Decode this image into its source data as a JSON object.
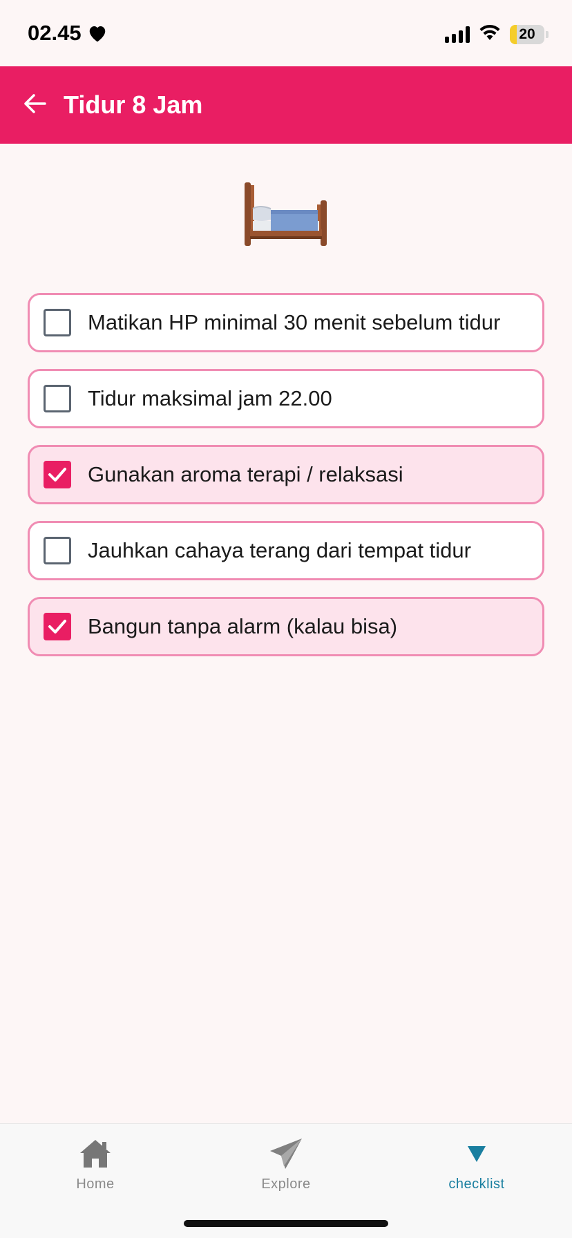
{
  "status_bar": {
    "time": "02.45",
    "battery_level": "20",
    "battery_fraction": 0.2
  },
  "app_bar": {
    "title": "Tidur 8 Jam",
    "back_icon": "arrow-left-icon",
    "background_color": "#e91e63"
  },
  "hero": {
    "emoji": "🛏️",
    "icon": "bed-icon"
  },
  "checklist": {
    "items": [
      {
        "label": "Matikan HP minimal 30 menit sebelum tidur",
        "checked": false
      },
      {
        "label": "Tidur maksimal jam 22.00",
        "checked": false
      },
      {
        "label": "Gunakan aroma terapi / relaksasi",
        "checked": true
      },
      {
        "label": "Jauhkan cahaya terang dari tempat tidur",
        "checked": false
      },
      {
        "label": "Bangun tanpa alarm (kalau bisa)",
        "checked": true
      }
    ],
    "accent_color": "#e91e63",
    "border_color": "#f08cb3",
    "checked_background": "#fde3ec"
  },
  "bottom_nav": {
    "items": [
      {
        "label": "Home",
        "icon": "home-icon",
        "active": false
      },
      {
        "label": "Explore",
        "icon": "paper-plane-icon",
        "active": false
      },
      {
        "label": "checklist",
        "icon": "triangle-down-icon",
        "active": true
      }
    ],
    "active_color": "#1a7fa0"
  }
}
